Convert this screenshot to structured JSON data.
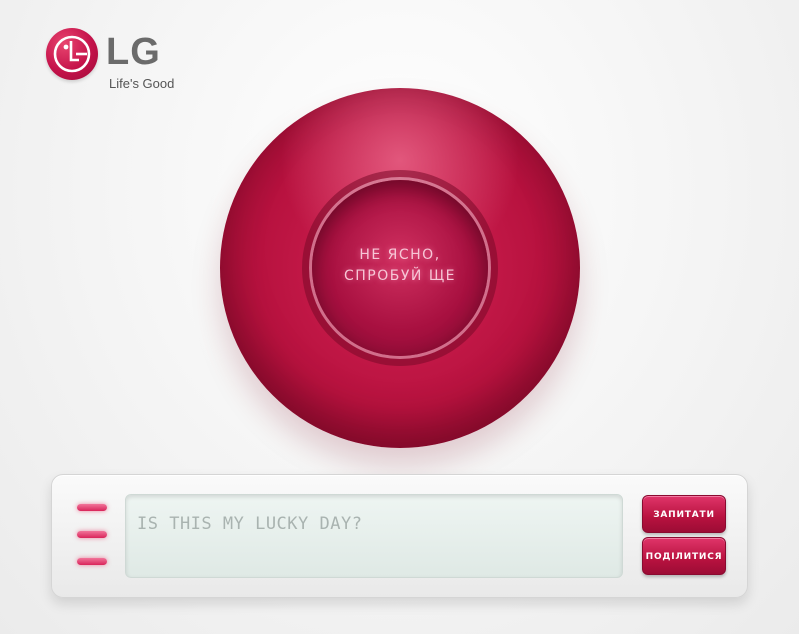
{
  "brand": {
    "name": "LG",
    "tagline": "Life's Good",
    "color": "#c4124a"
  },
  "ball": {
    "answer_lines": [
      "НЕ ЯСНО,",
      "СПРОБУЙ ЩЕ"
    ],
    "color": "#b8123f"
  },
  "console": {
    "indicator_count": 3,
    "question_text": "IS THIS MY LUCKY DAY?",
    "ask_button": "ЗАПИТАТИ",
    "share_button": "ПОДІЛИТИСЯ"
  }
}
